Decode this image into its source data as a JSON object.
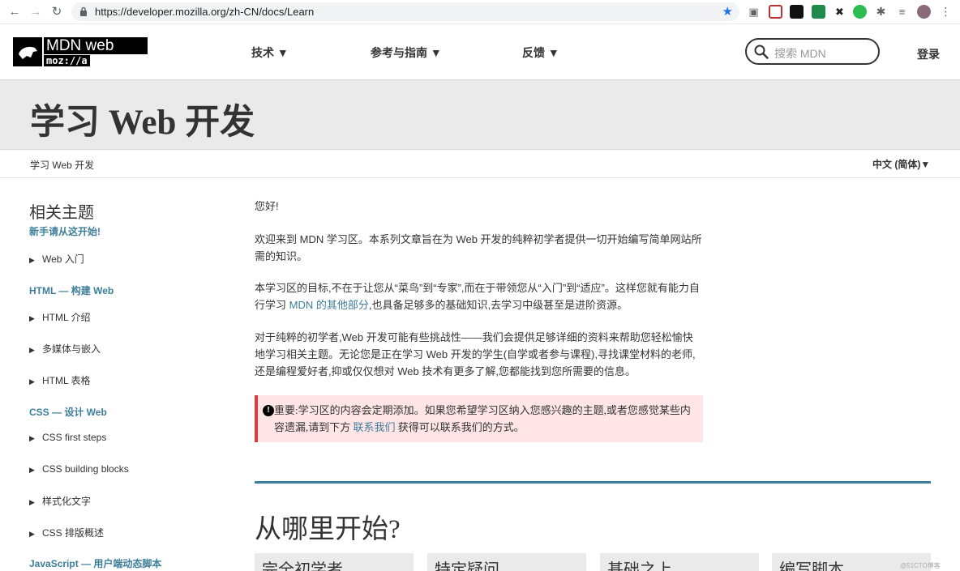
{
  "browser": {
    "url": "https://developer.mozilla.org/zh-CN/docs/Learn"
  },
  "header": {
    "logo_text": "MDN web docs",
    "logo_moz": "moz://a",
    "nav": [
      "技术 ▼",
      "参考与指南 ▼",
      "反馈 ▼"
    ],
    "search_placeholder": "搜索 MDN",
    "login": "登录"
  },
  "page": {
    "title": "学习 Web 开发",
    "breadcrumb": "学习 Web 开发",
    "language": "中文 (简体)▼"
  },
  "sidebar": {
    "title": "相关主题",
    "start_link": "新手请从这开始!",
    "web_intro": "Web 入门",
    "html_heading": "HTML — 构建 Web",
    "html_items": [
      "HTML 介绍",
      "多媒体与嵌入",
      "HTML 表格"
    ],
    "css_heading": "CSS — 设计 Web",
    "css_items": [
      "CSS first steps",
      "CSS building blocks",
      "样式化文字",
      "CSS 排版概述"
    ],
    "js_heading": "JavaScript — 用户端动态脚本"
  },
  "content": {
    "greeting": "您好!",
    "p1": "欢迎来到 MDN 学习区。本系列文章旨在为 Web 开发的纯粹初学者提供一切开始编写简单网站所需的知识。",
    "p2_before": "本学习区的目标,不在于让您从“菜鸟”到“专家”,而在于带领您从“入门”到“适应”。这样您就有能力自行学习 ",
    "p2_link": "MDN 的其他部分",
    "p2_after": ",也具备足够多的基础知识,去学习中级甚至是进阶资源。",
    "p3": "对于纯粹的初学者,Web 开发可能有些挑战性——我们会提供足够详细的资料来帮助您轻松愉快地学习相关主题。无论您是正在学习 Web 开发的学生(自学或者参与课程),寻找课堂材料的老师,还是编程爱好者,抑或仅仅想对 Web 技术有更多了解,您都能找到您所需要的信息。",
    "notice_before": "重要:学习区的内容会定期添加。如果您希望学习区纳入您感兴趣的主题,或者您感觉某些内容遗漏,请到下方 ",
    "notice_link": "联系我们",
    "notice_after": " 获得可以联系我们的方式。",
    "section_title": "从哪里开始?",
    "cards": [
      "完全初学者",
      "特定疑问",
      "基础之上",
      "编写脚本"
    ]
  },
  "watermark": "@51CTO博客",
  "colors": {
    "link": "#3d7e9a",
    "notice_bg": "#ffe5e5",
    "notice_border": "#d63c3c",
    "star": "#1a73e8"
  }
}
